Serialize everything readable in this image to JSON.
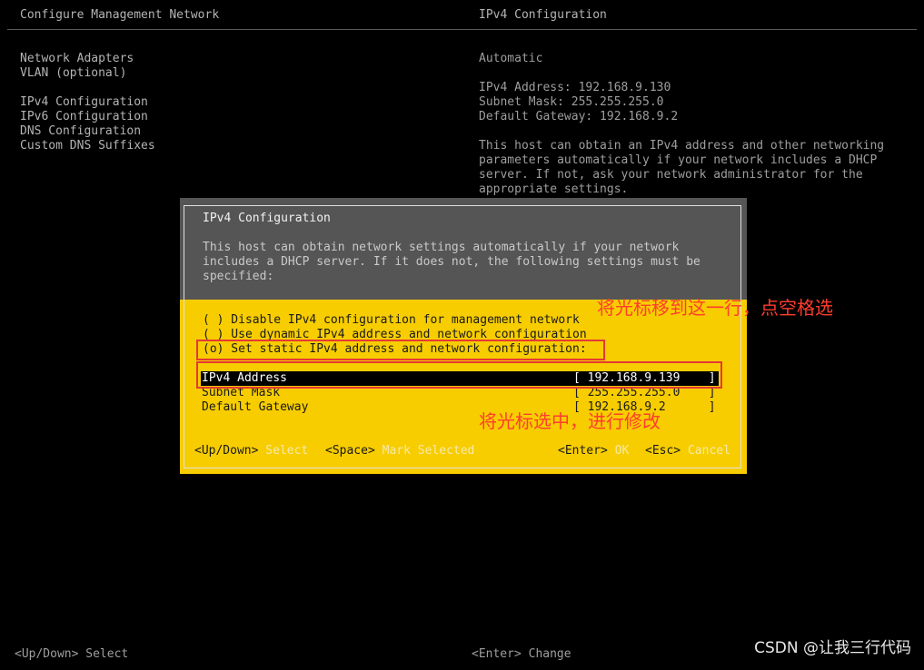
{
  "header": {
    "left_title": "Configure Management Network",
    "right_title": "IPv4 Configuration"
  },
  "menu": [
    {
      "label": "Network Adapters"
    },
    {
      "label": "VLAN (optional)"
    },
    {
      "label": "IPv4 Configuration"
    },
    {
      "label": "IPv6 Configuration"
    },
    {
      "label": "DNS Configuration"
    },
    {
      "label": "Custom DNS Suffixes"
    }
  ],
  "info": {
    "mode": "Automatic",
    "address_line": "IPv4 Address: 192.168.9.130",
    "mask_line": "Subnet Mask: 255.255.255.0",
    "gateway_line": "Default Gateway: 192.168.9.2",
    "description": [
      "This host can obtain an IPv4 address and other networking",
      "parameters automatically if your network includes a DHCP",
      "server. If not, ask your network administrator for the",
      "appropriate settings."
    ]
  },
  "dialog": {
    "title": "IPv4 Configuration",
    "description": [
      "This host can obtain network settings automatically if your network",
      "includes a DHCP server. If it does not, the following settings must be",
      "specified:"
    ],
    "options": [
      {
        "label": "( ) Disable IPv4 configuration for management network"
      },
      {
        "label": "( ) Use dynamic IPv4 address and network configuration"
      },
      {
        "label": "(o) Set static IPv4 address and network configuration:"
      }
    ],
    "fields": [
      {
        "label": "IPv4 Address",
        "value": "[ 192.168.9.139    ]"
      },
      {
        "label": "Subnet Mask",
        "value": "[ 255.255.255.0    ]"
      },
      {
        "label": "Default Gateway",
        "value": "[ 192.168.9.2      ]"
      }
    ],
    "hints": {
      "updown_key": "<Up/Down>",
      "updown_action": "Select",
      "space_key": "<Space>",
      "space_action": "Mark Selected",
      "enter_key": "<Enter>",
      "enter_action": "OK",
      "esc_key": "<Esc>",
      "esc_action": "Cancel"
    }
  },
  "annotations": {
    "option_note": "将光标移到这一行，点空格选",
    "field_note": "将光标选中，进行修改"
  },
  "footer": {
    "left": "<Up/Down> Select",
    "right": "<Enter> Change"
  },
  "watermark": "CSDN @让我三行代码",
  "colors": {
    "dialog_yellow": "#f7cd00",
    "dialog_header_gray": "#555555",
    "annotation_red": "#e53935"
  }
}
